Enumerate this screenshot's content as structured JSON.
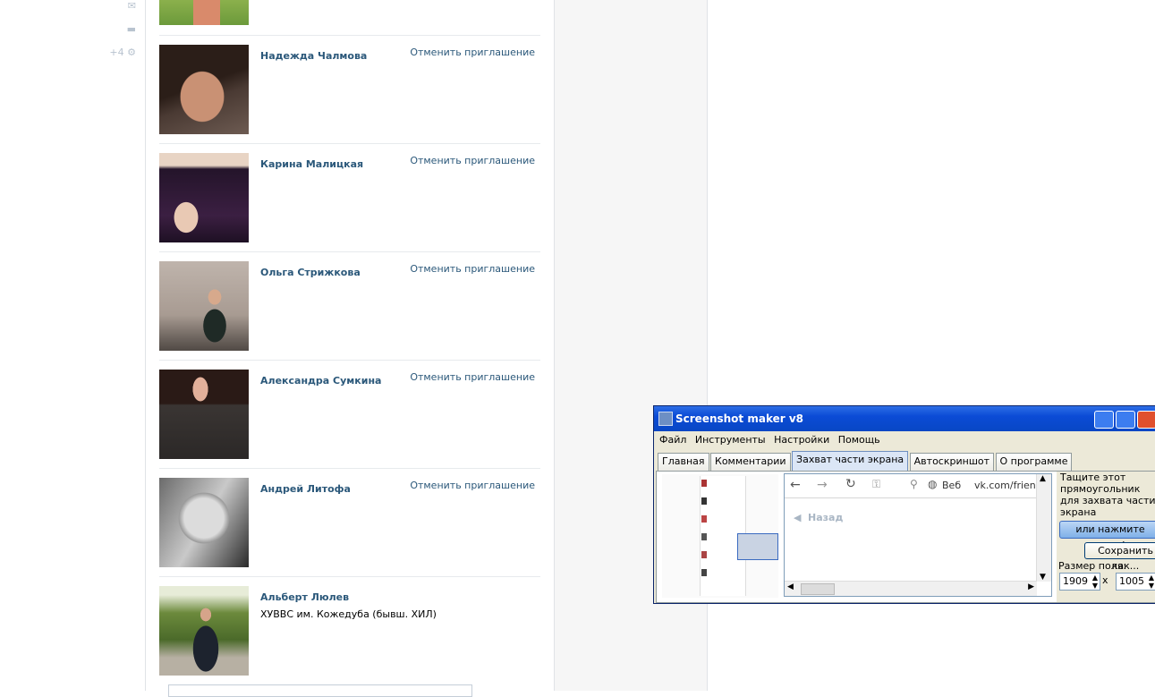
{
  "left_rail": {
    "counter": "+4"
  },
  "friends": [
    {
      "name": "Надежда Чалмова",
      "action": "Отменить приглашение",
      "subtitle": ""
    },
    {
      "name": "Карина Малицкая",
      "action": "Отменить приглашение",
      "subtitle": ""
    },
    {
      "name": "Ольга Стрижкова",
      "action": "Отменить приглашение",
      "subtitle": ""
    },
    {
      "name": "Александра Сумкина",
      "action": "Отменить приглашение",
      "subtitle": ""
    },
    {
      "name": "Андрей Литофа",
      "action": "Отменить приглашение",
      "subtitle": ""
    },
    {
      "name": "Альберт Люлев",
      "action": "",
      "subtitle": "ХУВВС им. Кожедуба (бывш. ХИЛ)"
    }
  ],
  "screenshot_maker": {
    "title": "Screenshot maker v8",
    "menu": [
      "Файл",
      "Инструменты",
      "Настройки",
      "Помощь"
    ],
    "tabs": [
      "Главная",
      "Комментарии",
      "Захват части экрана",
      "Автоскриншот",
      "О программе"
    ],
    "active_tab": "Захват части экрана",
    "browser": {
      "search_label": "Веб",
      "url": "vk.com/frienc",
      "back_link": "Назад"
    },
    "side": {
      "instruction": "Тащите этот прямоугольник для захвата части экрана",
      "click_button": "или нажмите сюда!",
      "save_button": "Сохранить как...",
      "size_label": "Размер поля:",
      "width": "1909",
      "height": "1005",
      "separator": "x"
    }
  }
}
